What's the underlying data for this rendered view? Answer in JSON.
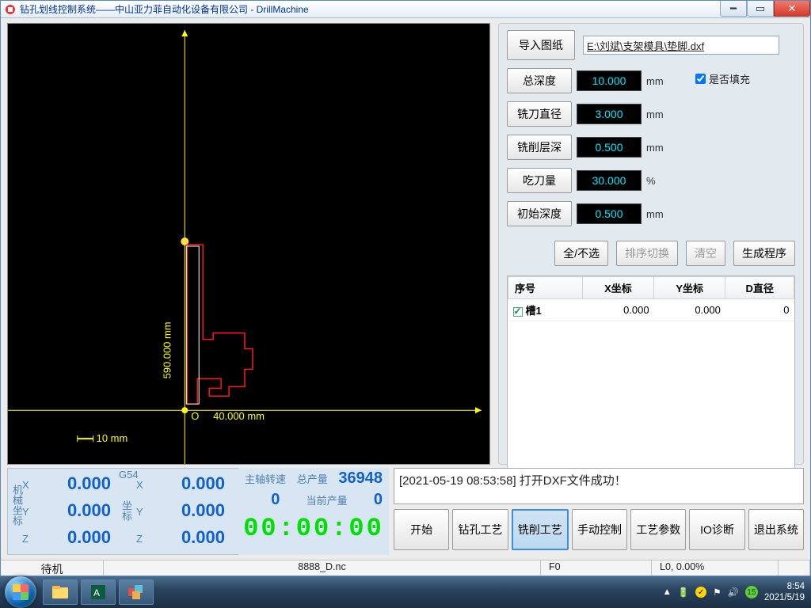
{
  "titlebar": {
    "title": "钻孔划线控制系统——中山亚力菲自动化设备有限公司 - DrillMachine"
  },
  "canvas": {
    "y_label": "590.000 mm",
    "x_label": "40.000 mm",
    "scale_label": "10 mm",
    "origin_label": "O"
  },
  "right": {
    "import_btn": "导入图纸",
    "filepath": "E:\\刘斌\\支架模具\\垫脚.dxf",
    "fill_label": "是否填充",
    "params": [
      {
        "label": "总深度",
        "value": "10.000",
        "unit": "mm"
      },
      {
        "label": "铣刀直径",
        "value": "3.000",
        "unit": "mm"
      },
      {
        "label": "铣削层深",
        "value": "0.500",
        "unit": "mm"
      },
      {
        "label": "吃刀量",
        "value": "30.000",
        "unit": "%"
      },
      {
        "label": "初始深度",
        "value": "0.500",
        "unit": "mm"
      }
    ],
    "actions": {
      "select_all": "全/不选",
      "sort_switch": "排序切换",
      "clear": "清空",
      "generate": "生成程序"
    },
    "table": {
      "headers": {
        "idx": "序号",
        "x": "X坐标",
        "y": "Y坐标",
        "d": "D直径"
      },
      "rows": [
        {
          "name": "槽1",
          "x": "0.000",
          "y": "0.000",
          "d": "0"
        }
      ]
    }
  },
  "coords": {
    "mech_label": "机械坐标",
    "wcs_label": "坐标",
    "g54": "G54",
    "rows": [
      {
        "axis": "X",
        "mech": "0.000",
        "wcs": "0.000"
      },
      {
        "axis": "Y",
        "mech": "0.000",
        "wcs": "0.000"
      },
      {
        "axis": "Z",
        "mech": "0.000",
        "wcs": "0.000"
      }
    ]
  },
  "mid": {
    "spindle_label": "主轴转速",
    "total_label": "总产量",
    "total_value": "36948",
    "blank_value": "0",
    "current_label": "当前产量",
    "current_value": "0",
    "timer": "00:00:00"
  },
  "log": {
    "text": "[2021-05-19 08:53:58]  打开DXF文件成功！"
  },
  "commands": {
    "start": "开始",
    "drill": "钻孔工艺",
    "mill": "铣削工艺",
    "manual": "手动控制",
    "params": "工艺参数",
    "io": "IO诊断",
    "exit": "退出系统"
  },
  "status": {
    "state": "待机",
    "file": "8888_D.nc",
    "feed": "F0",
    "line": "L0, 0.00%"
  },
  "taskbar": {
    "time": "8:54",
    "date": "2021/5/19",
    "ime_badge": "15"
  }
}
